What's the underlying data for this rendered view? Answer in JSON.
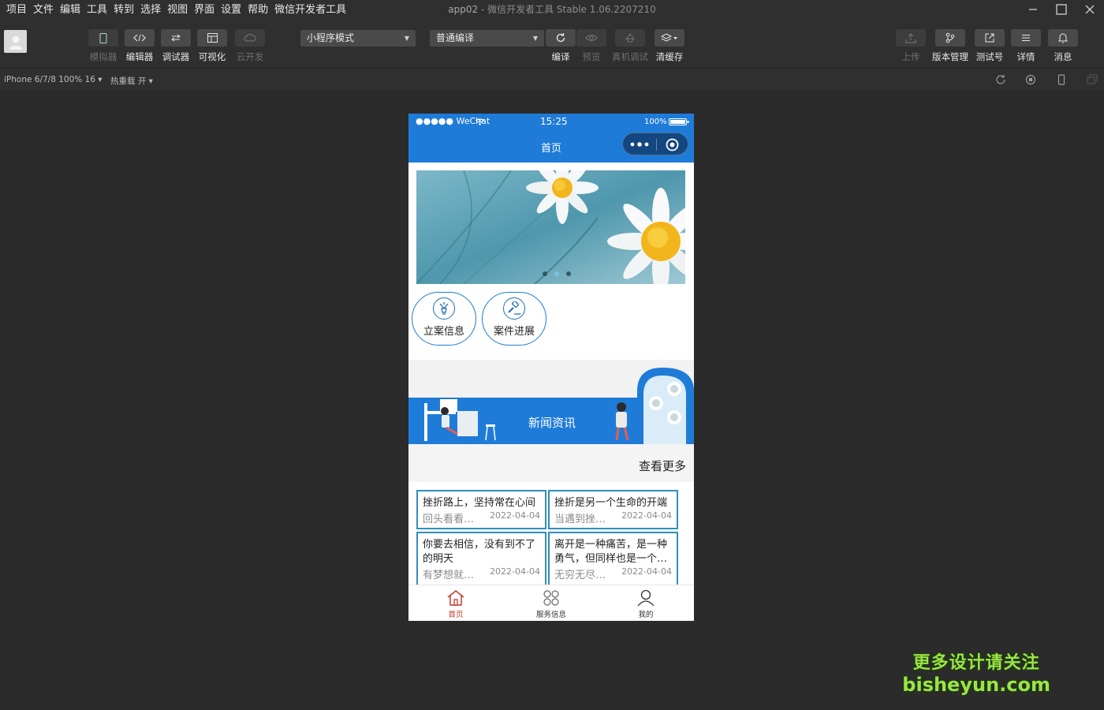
{
  "menubar": {
    "items": [
      "项目",
      "文件",
      "编辑",
      "工具",
      "转到",
      "选择",
      "视图",
      "界面",
      "设置",
      "帮助",
      "微信开发者工具"
    ],
    "app_name": "app02",
    "window_title": " - 微信开发者工具 Stable 1.06.2207210"
  },
  "toolbar": {
    "simulator": "模拟器",
    "editor": "编辑器",
    "debugger": "调试器",
    "visual": "可视化",
    "cloud": "云开发",
    "mode_select": "小程序模式",
    "compile_select": "普通编译",
    "compile": "编译",
    "preview": "预览",
    "remote_debug": "真机调试",
    "clear_cache": "清缓存",
    "upload": "上传",
    "version": "版本管理",
    "test_account": "测试号",
    "details": "详情",
    "messages": "消息"
  },
  "devbar": {
    "device": "iPhone 6/7/8 100% 16 ▾",
    "hot_reload": "热重载 开 ▾"
  },
  "phone": {
    "status": {
      "carrier": "●●●●● WeChat",
      "time": "15:25",
      "battery": "100%"
    },
    "nav_title": "首页",
    "quick_links": [
      {
        "label": "立案信息"
      },
      {
        "label": "案件进展"
      }
    ],
    "news_banner_title": "新闻资讯",
    "more_label": "查看更多",
    "news": [
      {
        "title": "挫折路上，坚持常在心间",
        "summary": "回头看看…",
        "date": "2022-04-04"
      },
      {
        "title": "挫折是另一个生命的开端",
        "summary": "当遇到挫…",
        "date": "2022-04-04"
      },
      {
        "title": "你要去相信，没有到不了的明天",
        "summary": "有梦想就…",
        "date": "2022-04-04"
      },
      {
        "title": "离开是一种痛苦，是一种勇气，但同样也是一个…",
        "summary": "无穷无尽…",
        "date": "2022-04-04"
      }
    ],
    "tabs": [
      {
        "label": "首页"
      },
      {
        "label": "服务信息"
      },
      {
        "label": "我的"
      }
    ]
  },
  "watermark": {
    "line1": "更多设计请关注",
    "line2": "bisheyun.com"
  },
  "colors": {
    "brand_blue": "#1f7bd8",
    "tab_active": "#c53a2b",
    "card_border": "#2f8fbf",
    "ide_bg": "#2b2b2b"
  }
}
